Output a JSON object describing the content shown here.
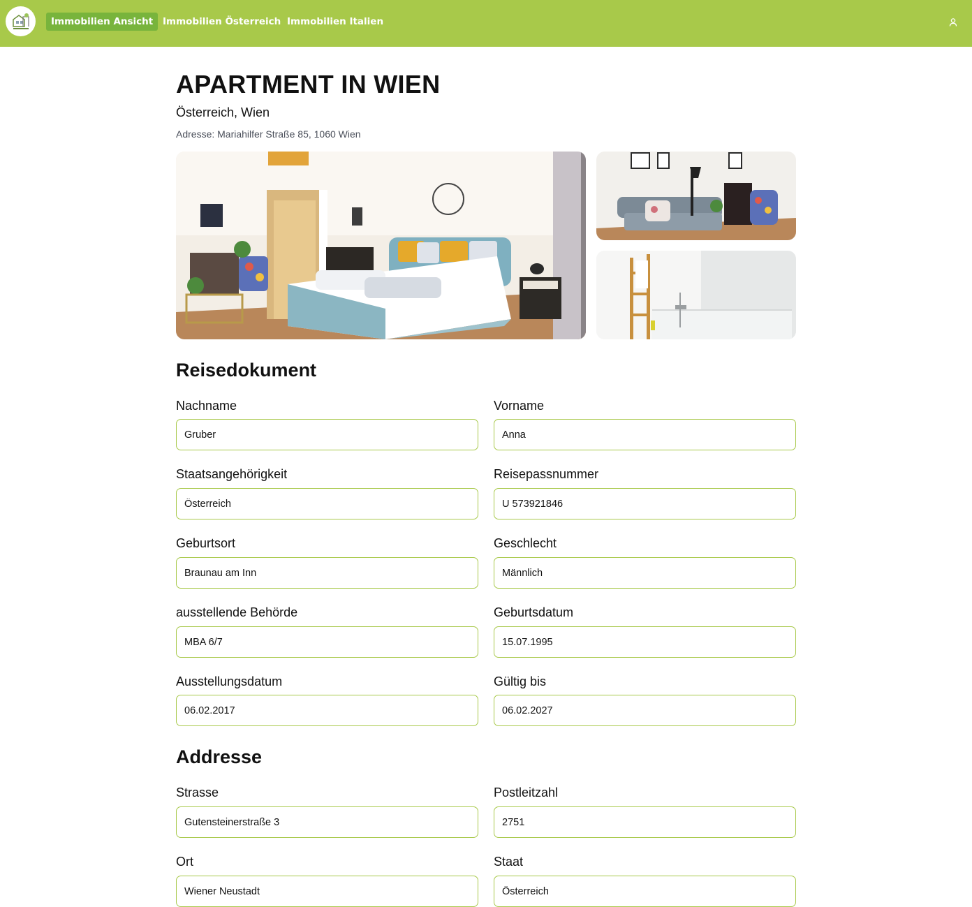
{
  "nav": {
    "items": [
      {
        "label": "Immobilien Ansicht",
        "active": true
      },
      {
        "label": "Immobilien Österreich",
        "active": false
      },
      {
        "label": "Immobilien Italien",
        "active": false
      }
    ],
    "user_icon": "user-icon",
    "logo_icon": "house-logo-icon"
  },
  "property": {
    "title": "APARTMENT IN WIEN",
    "location": "Österreich, Wien",
    "address": "Adresse: Mariahilfer Straße 85, 1060 Wien"
  },
  "photos": [
    {
      "subject": "bedroom"
    },
    {
      "subject": "living-room-sofa"
    },
    {
      "subject": "bathroom"
    }
  ],
  "travel_document": {
    "section_title": "Reisedokument",
    "fields": [
      {
        "label": "Nachname",
        "value": "Gruber"
      },
      {
        "label": "Vorname",
        "value": "Anna"
      },
      {
        "label": "Staatsangehörigkeit",
        "value": "Österreich"
      },
      {
        "label": "Reisepassnummer",
        "value": "U 573921846"
      },
      {
        "label": "Geburtsort",
        "value": "Braunau am Inn"
      },
      {
        "label": "Geschlecht",
        "value": "Männlich"
      },
      {
        "label": "ausstellende Behörde",
        "value": "MBA 6/7"
      },
      {
        "label": "Geburtsdatum",
        "value": "15.07.1995"
      },
      {
        "label": "Ausstellungsdatum",
        "value": "06.02.2017"
      },
      {
        "label": "Gültig bis",
        "value": "06.02.2027"
      }
    ]
  },
  "address": {
    "section_title": "Addresse",
    "fields": [
      {
        "label": "Strasse",
        "value": "Gutensteinerstraße 3"
      },
      {
        "label": "Postleitzahl",
        "value": "2751"
      },
      {
        "label": "Ort",
        "value": "Wiener Neustadt"
      },
      {
        "label": "Staat",
        "value": "Österreich"
      }
    ]
  },
  "colors": {
    "accent": "#a8c94a",
    "nav_active": "#78b43c",
    "input_border": "#a8c94a"
  }
}
